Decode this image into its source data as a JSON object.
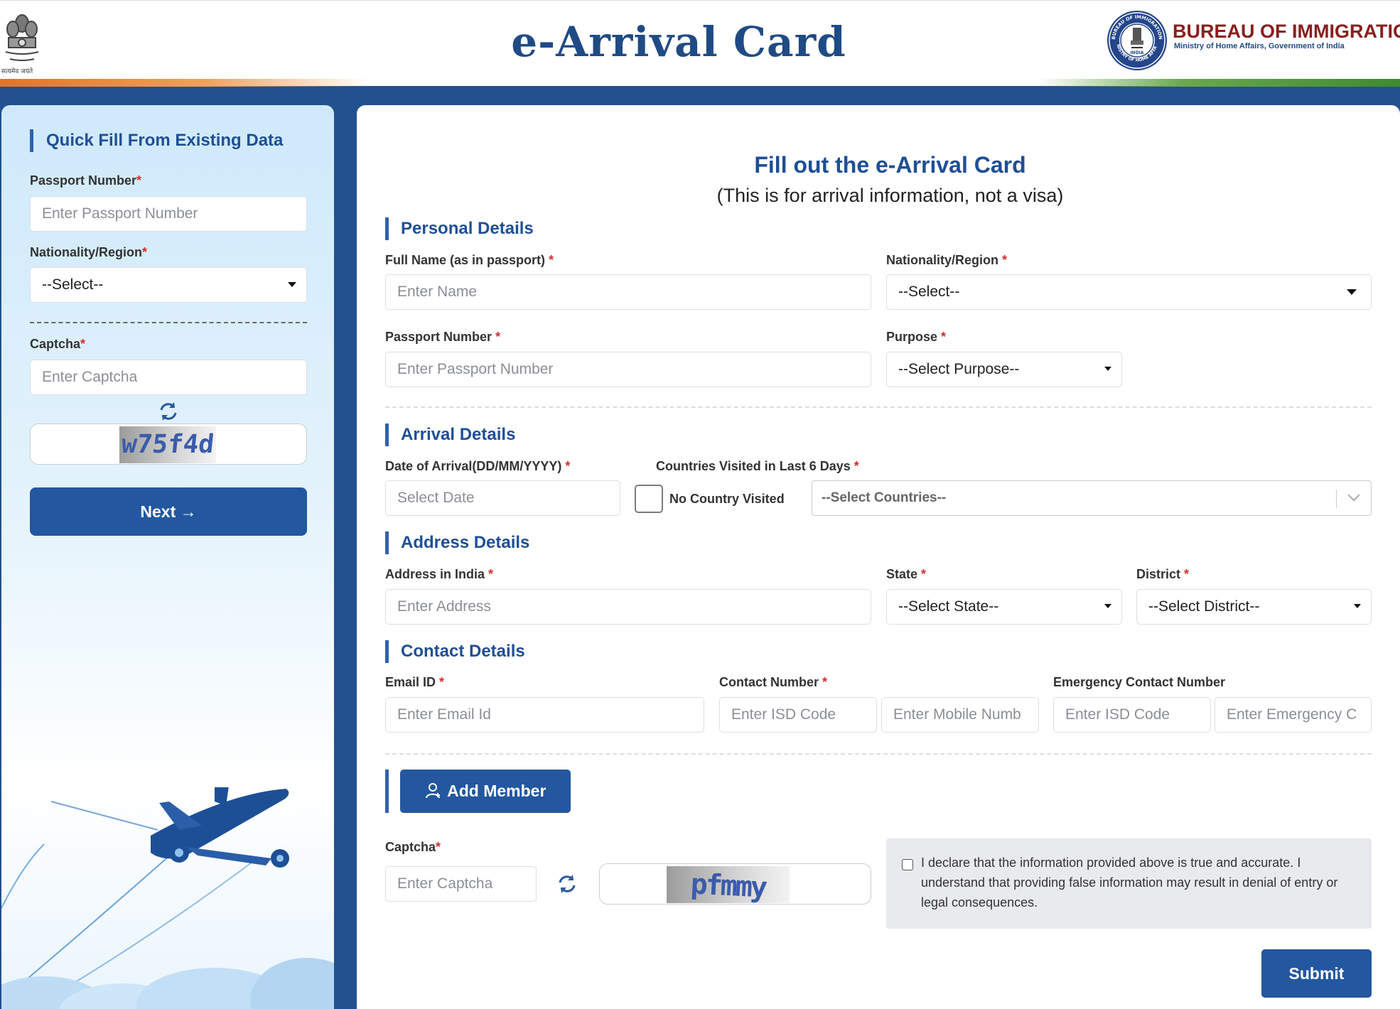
{
  "header": {
    "title": "e-Arrival Card",
    "emblem_caption": "सत्यमेव जयते",
    "org_name": "BUREAU OF IMMIGRATION",
    "org_subtitle": "Ministry of Home Affairs, Government of India",
    "seal_top_text": "BUREAU OF IMMIGRATION",
    "seal_bottom_text": "MINISTRY OF HOME AFFAIRS",
    "seal_center_text": "INDIA"
  },
  "quick_fill": {
    "title": "Quick Fill From Existing Data",
    "passport_label": "Passport Number",
    "passport_placeholder": "Enter Passport Number",
    "nationality_label": "Nationality/Region",
    "nationality_value": "--Select--",
    "captcha_label": "Captcha",
    "captcha_placeholder": "Enter Captcha",
    "captcha_text": "w75f4d",
    "next_label": "Next",
    "required_mark": "*"
  },
  "form": {
    "title": "Fill out the e-Arrival Card",
    "subtitle": "(This is for arrival information, not a visa)",
    "required_mark": "*",
    "personal": {
      "section_title": "Personal Details",
      "full_name_label": "Full Name (as in passport)",
      "full_name_placeholder": "Enter Name",
      "nationality_label": "Nationality/Region",
      "nationality_value": "--Select--",
      "passport_label": "Passport Number",
      "passport_placeholder": "Enter Passport Number",
      "purpose_label": "Purpose",
      "purpose_value": "--Select Purpose--"
    },
    "arrival": {
      "section_title": "Arrival Details",
      "date_label": "Date of Arrival(DD/MM/YYYY)",
      "date_placeholder": "Select Date",
      "countries_label": "Countries Visited in Last 6 Days",
      "no_country_label": "No Country Visited",
      "countries_placeholder": "--Select Countries--"
    },
    "address": {
      "section_title": "Address Details",
      "address_label": "Address in India",
      "address_placeholder": "Enter Address",
      "state_label": "State",
      "state_value": "--Select State--",
      "district_label": "District",
      "district_value": "--Select District--"
    },
    "contact": {
      "section_title": "Contact Details",
      "email_label": "Email ID",
      "email_placeholder": "Enter Email Id",
      "contact_label": "Contact Number",
      "isd_placeholder": "Enter ISD Code",
      "mobile_placeholder": "Enter Mobile Numb",
      "emergency_label": "Emergency Contact Number",
      "emergency_isd_placeholder": "Enter ISD Code",
      "emergency_placeholder": "Enter Emergency C"
    },
    "add_member_label": "Add Member",
    "captcha_label": "Captcha",
    "captcha_placeholder": "Enter Captcha",
    "captcha_text": "pfmmy",
    "declaration": "I declare that the information provided above is true and accurate. I understand that providing false information may result in denial of entry or legal consequences.",
    "submit_label": "Submit"
  },
  "colors": {
    "brand_blue": "#23579f",
    "title_blue": "#1f4f96",
    "required_red": "#d62d2d",
    "page_background": "#23508f"
  }
}
